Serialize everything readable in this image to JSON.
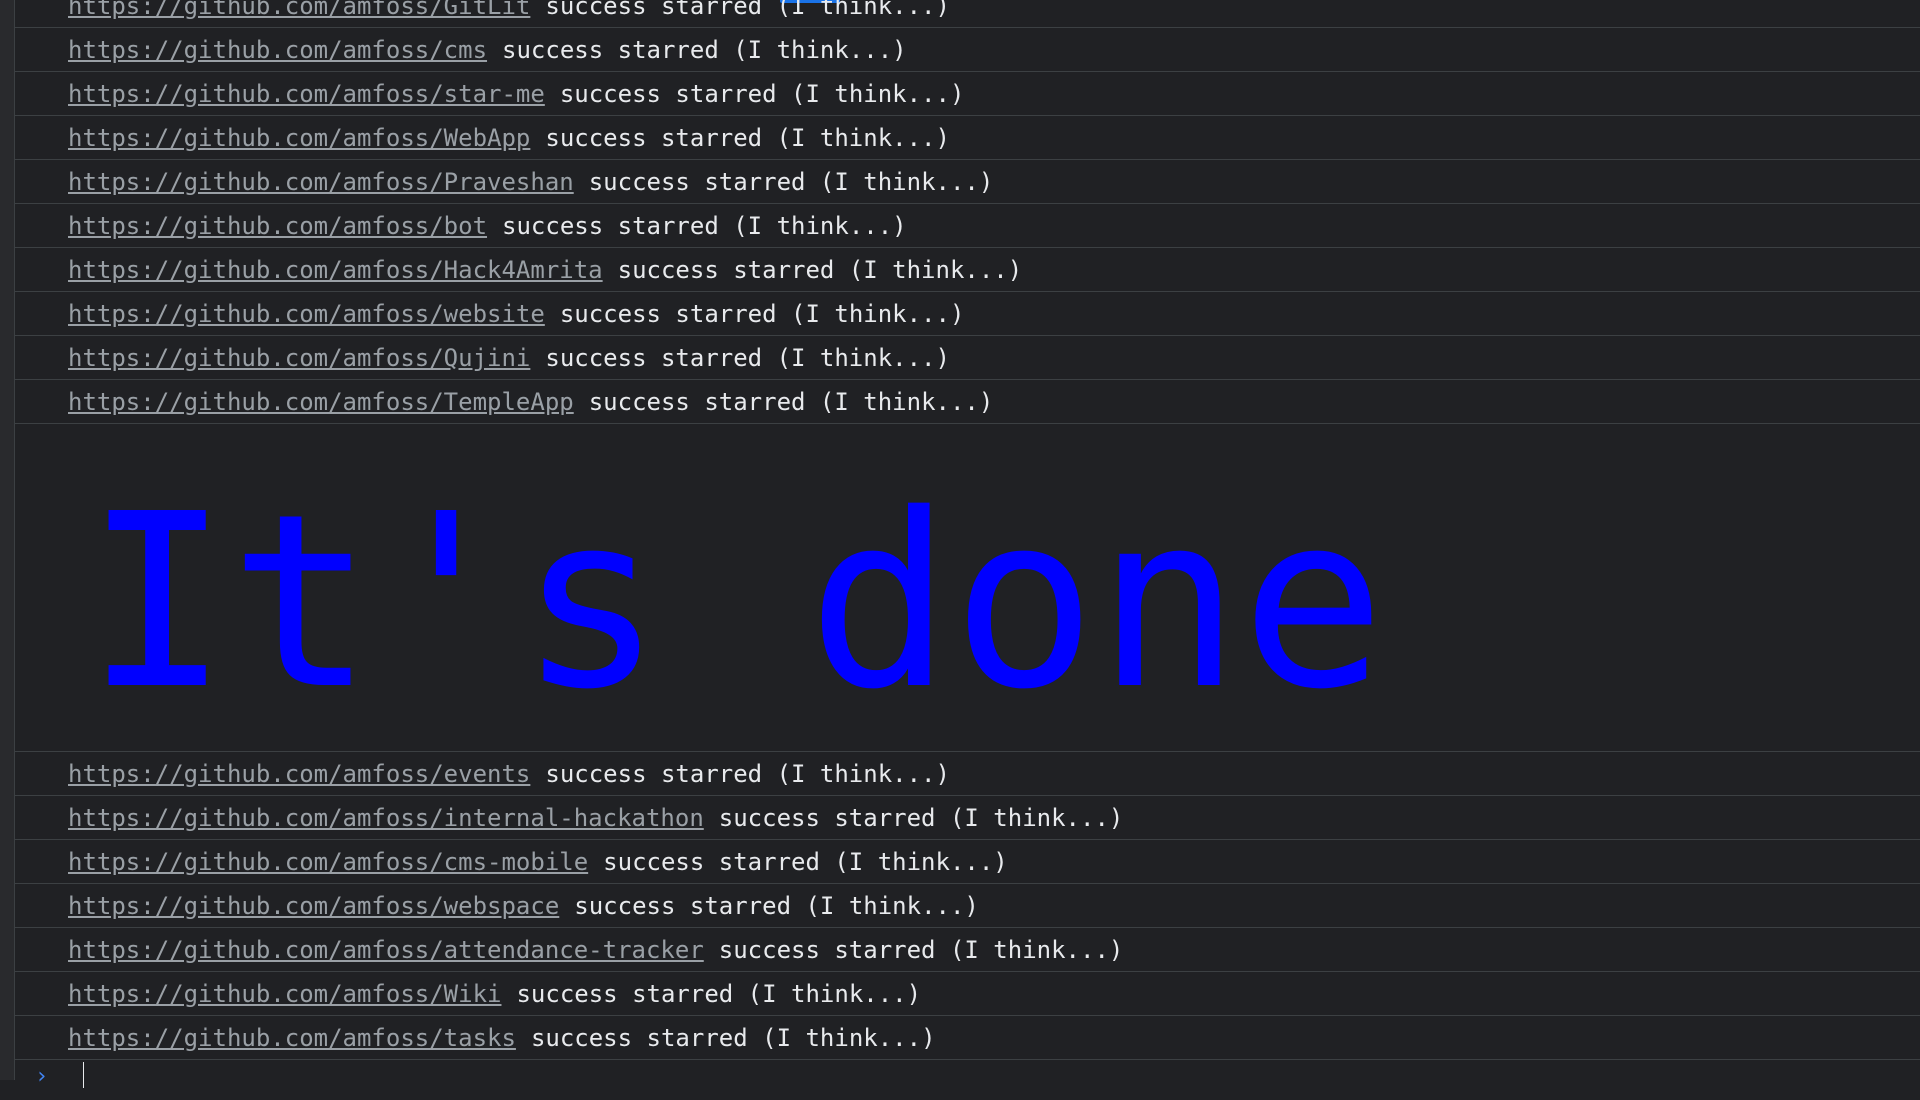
{
  "log_rows_top": [
    {
      "url": "https://github.com/amfoss/GitLit",
      "message": "success starred (I think...)"
    },
    {
      "url": "https://github.com/amfoss/cms",
      "message": "success starred (I think...)"
    },
    {
      "url": "https://github.com/amfoss/star-me",
      "message": "success starred (I think...)"
    },
    {
      "url": "https://github.com/amfoss/WebApp",
      "message": "success starred (I think...)"
    },
    {
      "url": "https://github.com/amfoss/Praveshan",
      "message": "success starred (I think...)"
    },
    {
      "url": "https://github.com/amfoss/bot",
      "message": "success starred (I think...)"
    },
    {
      "url": "https://github.com/amfoss/Hack4Amrita",
      "message": "success starred (I think...)"
    },
    {
      "url": "https://github.com/amfoss/website",
      "message": "success starred (I think...)"
    },
    {
      "url": "https://github.com/amfoss/Qujini",
      "message": "success starred (I think...)"
    },
    {
      "url": "https://github.com/amfoss/TempleApp",
      "message": "success starred (I think...)"
    }
  ],
  "big_message": "It's done",
  "big_message_color": "#0000ff",
  "log_rows_bottom": [
    {
      "url": "https://github.com/amfoss/events",
      "message": "success starred (I think...)"
    },
    {
      "url": "https://github.com/amfoss/internal-hackathon",
      "message": "success starred (I think...)"
    },
    {
      "url": "https://github.com/amfoss/cms-mobile",
      "message": "success starred (I think...)"
    },
    {
      "url": "https://github.com/amfoss/webspace",
      "message": "success starred (I think...)"
    },
    {
      "url": "https://github.com/amfoss/attendance-tracker",
      "message": "success starred (I think...)"
    },
    {
      "url": "https://github.com/amfoss/Wiki",
      "message": "success starred (I think...)"
    },
    {
      "url": "https://github.com/amfoss/tasks",
      "message": "success starred (I think...)"
    }
  ],
  "prompt": {
    "chevron_icon": "chevron-right-icon",
    "chevron_glyph": "›"
  },
  "colors": {
    "background": "#202124",
    "link": "#9aa0a6",
    "text": "#e8eaed",
    "prompt_accent": "#4285f4"
  }
}
